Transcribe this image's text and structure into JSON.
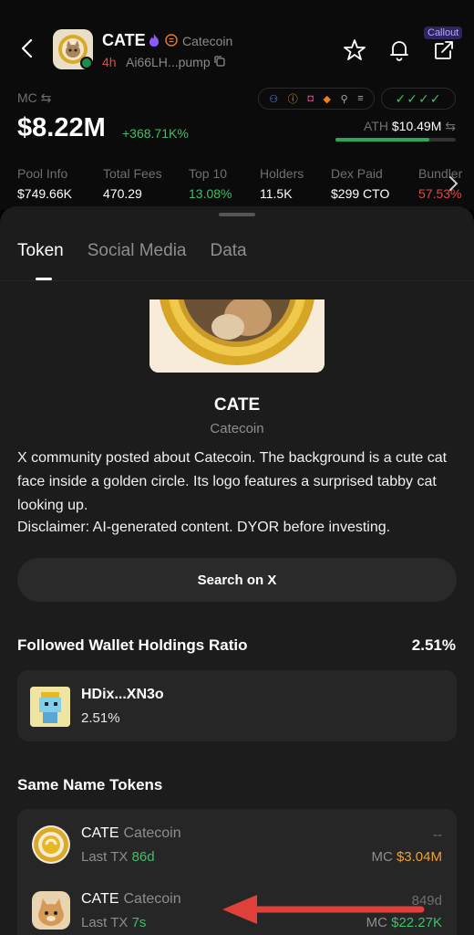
{
  "header": {
    "token_symbol": "CATE",
    "token_name": "Catecoin",
    "age": "4h",
    "address": "Ai66LH...pump",
    "callout_label": "Callout"
  },
  "market": {
    "mc_label": "MC",
    "mc_value": "$8.22M",
    "mc_change": "+368.71K%",
    "ath_label": "ATH",
    "ath_value": "$10.49M",
    "ath_progress_pct": 78
  },
  "stats": [
    {
      "label": "Pool Info",
      "value": "$749.66K",
      "color": "#ffffff"
    },
    {
      "label": "Total Fees",
      "value": "470.29",
      "color": "#ffffff"
    },
    {
      "label": "Top 10",
      "value": "13.08%",
      "color": "#3fbf6a"
    },
    {
      "label": "Holders",
      "value": "11.5K",
      "color": "#ffffff"
    },
    {
      "label": "Dex Paid",
      "value": "$299 CTO",
      "color": "#ffffff"
    },
    {
      "label": "Bundler",
      "value": "57.53%",
      "color": "#e04848"
    }
  ],
  "tabs": [
    "Token",
    "Social Media",
    "Data"
  ],
  "token_info": {
    "name": "CATE",
    "full_name": "Catecoin",
    "description": "X community posted about Catecoin. The background is a cute cat face inside a golden circle. Its logo features a surprised tabby cat looking up.",
    "disclaimer": "Disclaimer: AI-generated content. DYOR before investing.",
    "search_button": "Search on X"
  },
  "followed": {
    "title": "Followed Wallet Holdings Ratio",
    "ratio": "2.51%",
    "wallet_name": "HDix...XN3o",
    "wallet_pct": "2.51%"
  },
  "same_name": {
    "title": "Same Name Tokens",
    "rows": [
      {
        "symbol": "CATE",
        "name": "Catecoin",
        "tx_label": "Last TX",
        "tx_value": "86d",
        "age": "--",
        "mc_label": "MC",
        "mc_value": "$3.04M"
      },
      {
        "symbol": "CATE",
        "name": "Catecoin",
        "tx_label": "Last TX",
        "tx_value": "7s",
        "age": "849d",
        "mc_label": "MC",
        "mc_value": "$22.27K"
      }
    ]
  },
  "colors": {
    "accent_green": "#3fbf6a",
    "accent_red": "#e04848",
    "accent_orange": "#f0a030",
    "annotation_arrow": "#e0403a"
  }
}
